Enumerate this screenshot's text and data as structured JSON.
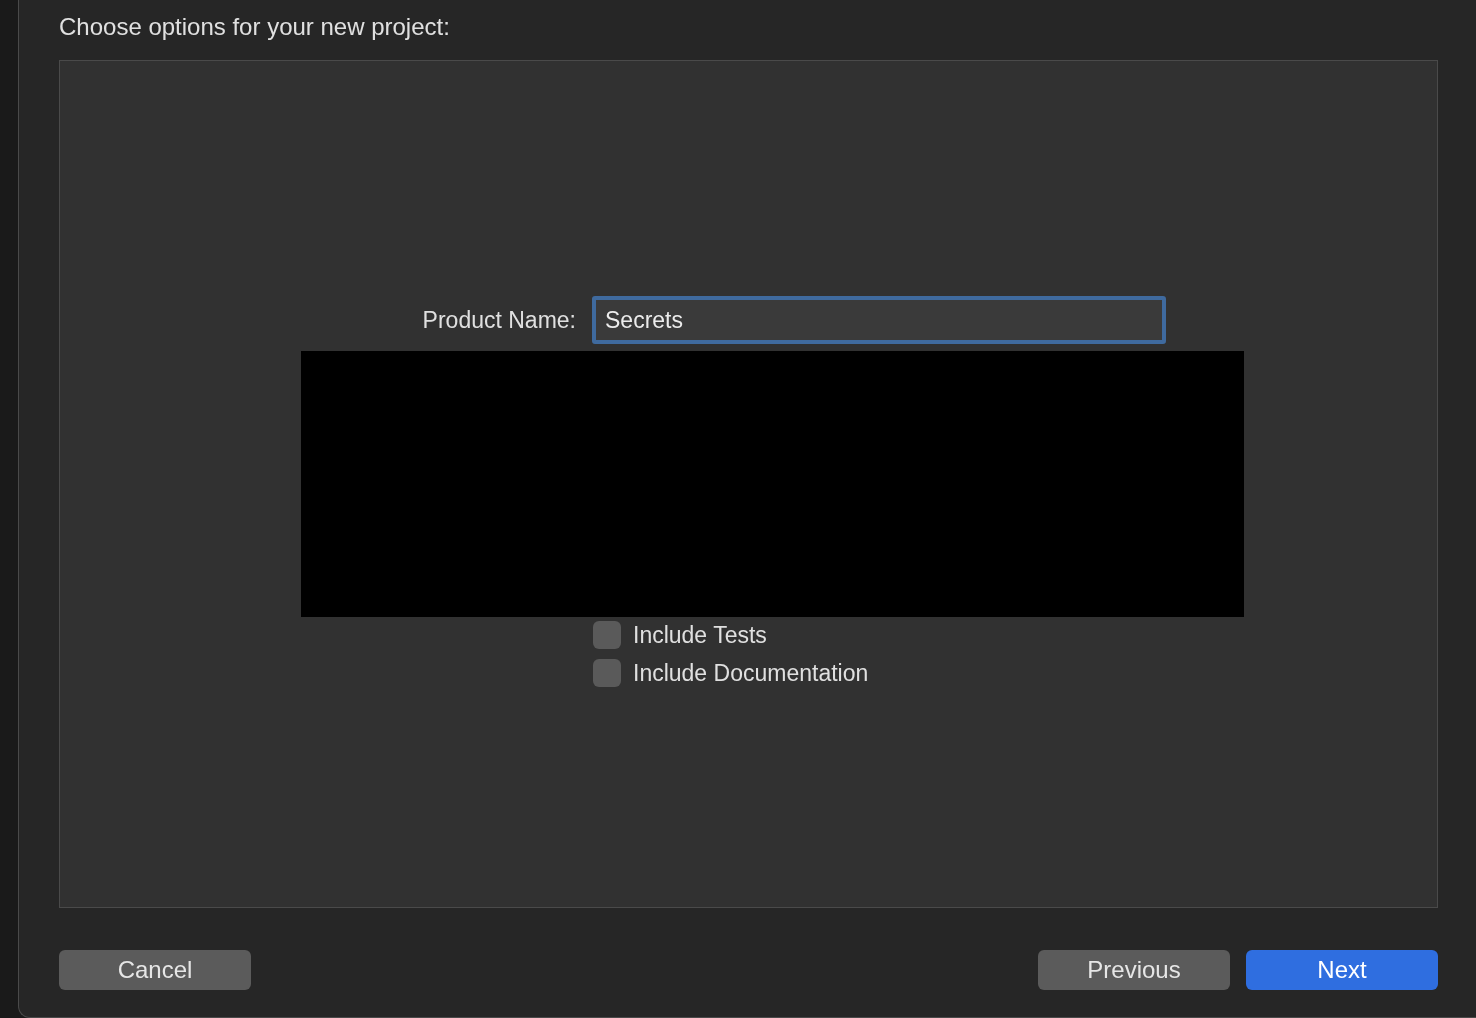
{
  "dialog": {
    "title": "Choose options for your new project:"
  },
  "product_name": {
    "label": "Product Name:",
    "value": "Secrets",
    "focused": true
  },
  "options": [
    {
      "label": "Include Tests",
      "checked": false
    },
    {
      "label": "Include Documentation",
      "checked": false
    }
  ],
  "buttons": [
    {
      "label": "Cancel",
      "kind": "secondary"
    },
    {
      "label": "Previous",
      "kind": "secondary"
    },
    {
      "label": "Next",
      "kind": "primary"
    }
  ]
}
